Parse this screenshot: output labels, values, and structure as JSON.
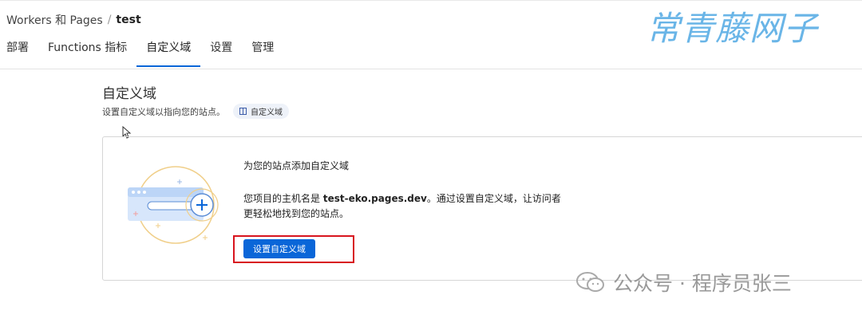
{
  "breadcrumb": {
    "root": "Workers 和 Pages",
    "separator": "/",
    "current": "test"
  },
  "tabs": [
    {
      "label": "部署"
    },
    {
      "label": "Functions 指标"
    },
    {
      "label": "自定义域"
    },
    {
      "label": "设置"
    },
    {
      "label": "管理"
    }
  ],
  "active_tab": "自定义域",
  "watermark": "常青藤网子",
  "section": {
    "title": "自定义域",
    "description": "设置自定义域以指向您的站点。",
    "doc_link": "自定义域"
  },
  "card": {
    "heading": "为您的站点添加自定义域",
    "text_prefix": "您项目的主机名是 ",
    "hostname": "test-eko.pages.dev",
    "text_suffix": "。通过设置自定义域，让访问者",
    "text_line2": "更轻松地找到您的站点。",
    "button_label": "设置自定义域"
  },
  "footer_watermark": "公众号 · 程序员张三",
  "colors": {
    "accent": "#0a66d8",
    "highlight_border": "#d8141e",
    "watermark": "#5aaee5"
  }
}
